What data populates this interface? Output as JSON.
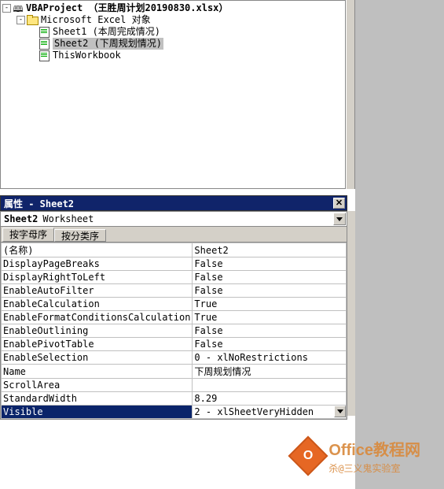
{
  "tree": {
    "project_label": "VBAProject （王胜周计划20190830.xlsx）",
    "folder_label": "Microsoft Excel 对象",
    "items": [
      {
        "label": "Sheet1 (本周完成情况)"
      },
      {
        "label": "Sheet2 (下周规划情况)"
      },
      {
        "label": "ThisWorkbook"
      }
    ]
  },
  "props_title": "属性 - Sheet2",
  "object": {
    "name": "Sheet2",
    "type": "Worksheet"
  },
  "tabs": {
    "alpha": "按字母序",
    "cat": "按分类序"
  },
  "properties": [
    {
      "k": "(名称)",
      "v": "Sheet2"
    },
    {
      "k": "DisplayPageBreaks",
      "v": "False"
    },
    {
      "k": "DisplayRightToLeft",
      "v": "False"
    },
    {
      "k": "EnableAutoFilter",
      "v": "False"
    },
    {
      "k": "EnableCalculation",
      "v": "True"
    },
    {
      "k": "EnableFormatConditionsCalculation",
      "v": "True"
    },
    {
      "k": "EnableOutlining",
      "v": "False"
    },
    {
      "k": "EnablePivotTable",
      "v": "False"
    },
    {
      "k": "EnableSelection",
      "v": "0 - xlNoRestrictions"
    },
    {
      "k": "Name",
      "v": "下周规划情况"
    },
    {
      "k": "ScrollArea",
      "v": ""
    },
    {
      "k": "StandardWidth",
      "v": "8.29"
    },
    {
      "k": "Visible",
      "v": "2 - xlSheetVeryHidden"
    }
  ],
  "selected_property_index": 12,
  "watermark": {
    "badge": "O",
    "line1": "Office教程网",
    "line2": "杀@三义鬼实验室"
  }
}
